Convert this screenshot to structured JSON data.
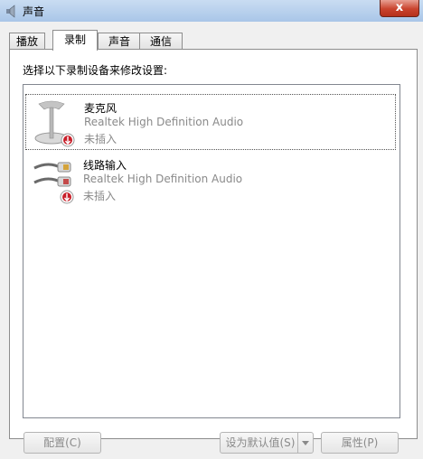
{
  "window": {
    "title": "声音",
    "close_glyph": "x"
  },
  "tabs": [
    {
      "label": "播放",
      "active": false
    },
    {
      "label": "录制",
      "active": true
    },
    {
      "label": "声音",
      "active": false
    },
    {
      "label": "通信",
      "active": false
    }
  ],
  "instruction": "选择以下录制设备来修改设置:",
  "devices": [
    {
      "name": "麦克风",
      "driver": "Realtek High Definition Audio",
      "status": "未插入",
      "icon": "microphone-icon",
      "selected": true
    },
    {
      "name": "线路输入",
      "driver": "Realtek High Definition Audio",
      "status": "未插入",
      "icon": "line-in-cable-icon",
      "selected": false
    }
  ],
  "buttons": {
    "configure": "配置(C)",
    "set_default": "设为默认值(S)",
    "properties": "属性(P)"
  },
  "colors": {
    "disabled_text": "#8a8a8a",
    "status_badge": "#c8202a"
  }
}
